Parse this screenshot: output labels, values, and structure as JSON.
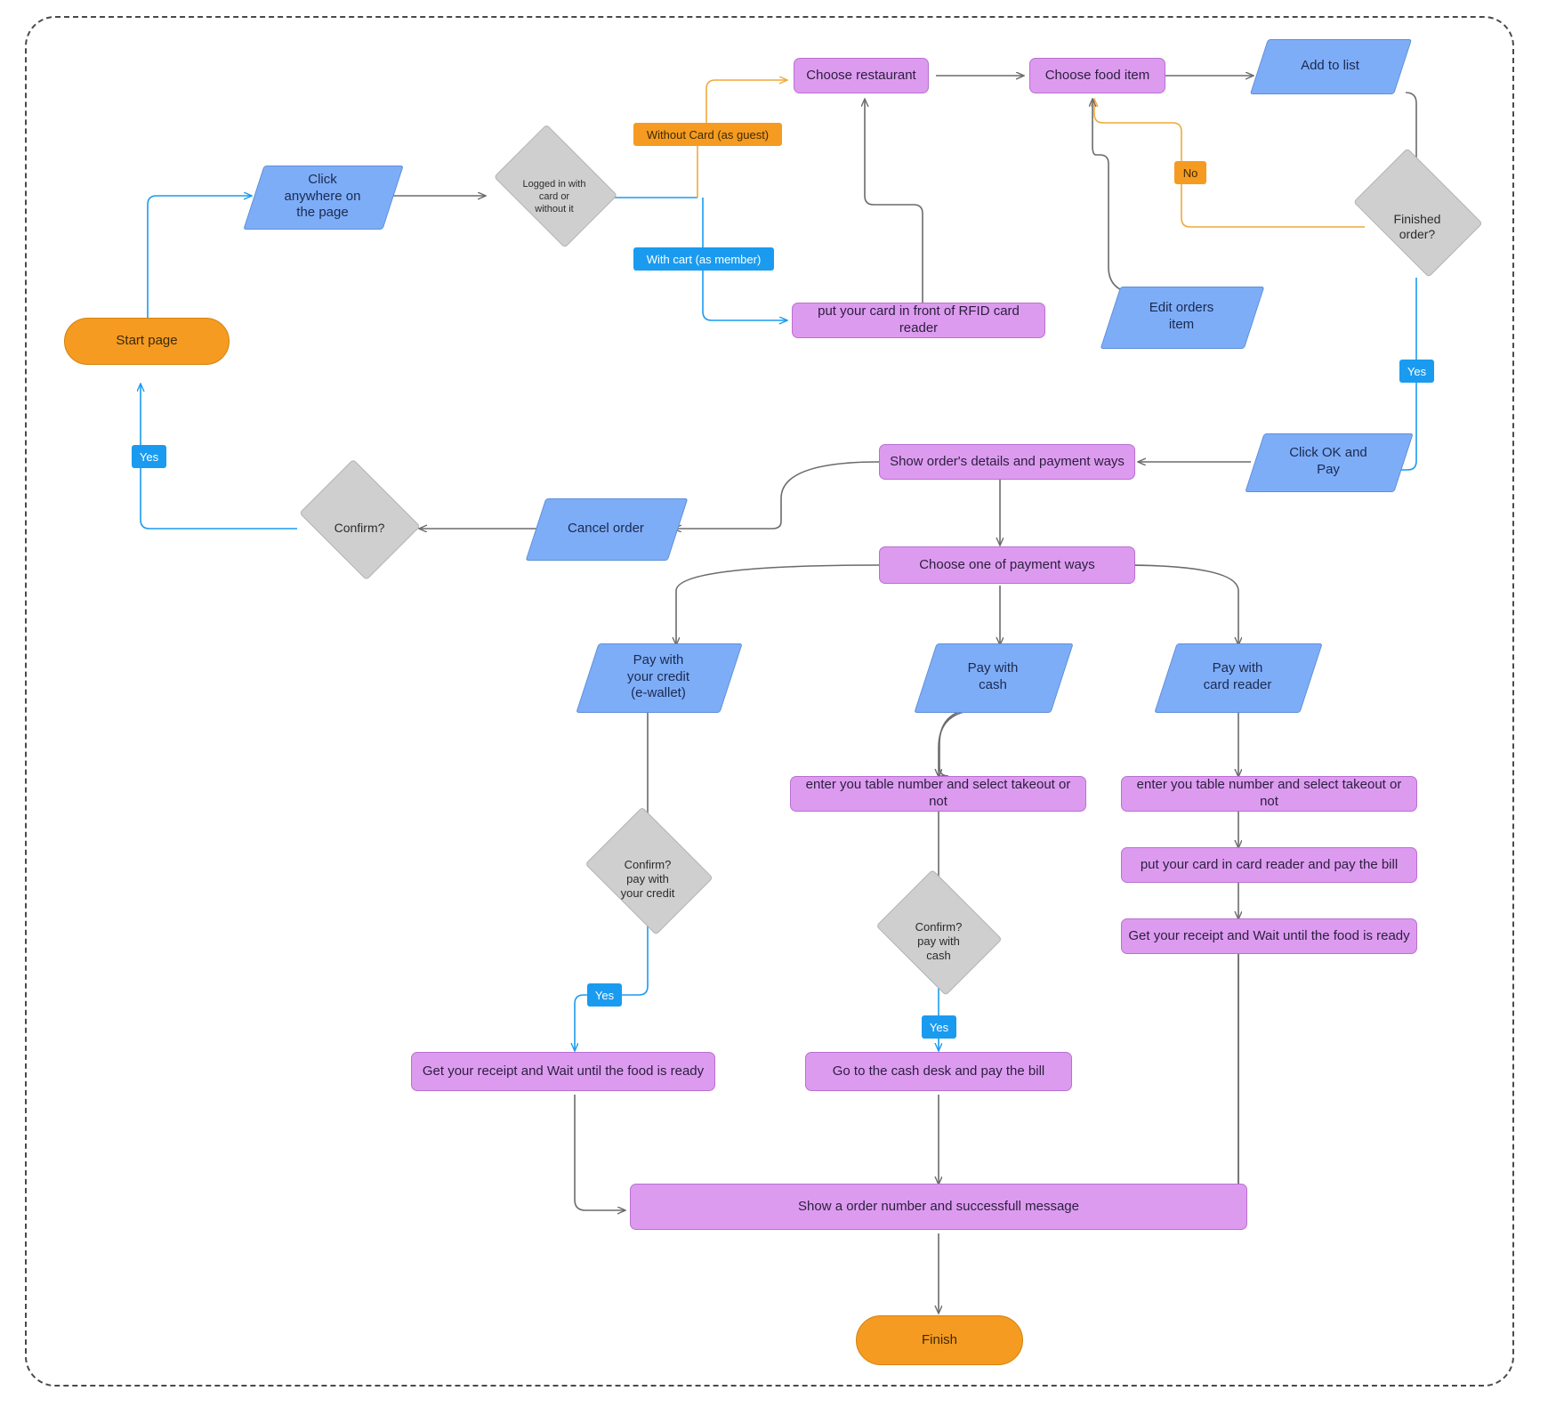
{
  "diagram": {
    "title": "Food ordering kiosk flowchart",
    "colors": {
      "process": "#dd9bf0",
      "io": "#7eadf8",
      "decision": "#cfcfcf",
      "terminator": "#f59b21",
      "edge_default": "#6b6b6b",
      "edge_blue": "#1a9bf0",
      "edge_orange": "#f0a93c",
      "label_blue": "#1a9bf0",
      "label_orange": "#f59b21"
    }
  },
  "nodes": {
    "start_page": "Start page",
    "click_anywhere": "Click\nanywhere on\nthe page",
    "logged_in": "Logged in with\ncard or\nwithout it",
    "choose_restaurant": "Choose restaurant",
    "choose_food_item": "Choose food item",
    "add_to_list": "Add to list",
    "rfid_reader": "put your card in front of RFID card reader",
    "finished_order": "Finished\norder?",
    "edit_orders_item": "Edit orders\nitem",
    "click_ok_and_pay": "Click OK and\nPay",
    "show_order_details": "Show order's details and payment ways",
    "cancel_order": "Cancel order",
    "confirm": "Confirm?",
    "choose_payment": "Choose one of payment ways",
    "pay_credit": "Pay with\nyour credit\n(e-wallet)",
    "pay_cash": "Pay with\ncash",
    "pay_card_reader": "Pay with\ncard reader",
    "confirm_credit": "Confirm?\npay with\nyour credit",
    "confirm_cash": "Confirm?\npay with\ncash",
    "table_number_cash": "enter you table number and select takeout or not",
    "table_number_card": "enter you table number and select takeout or not",
    "card_in_reader": "put your card in card reader and pay the bill",
    "receipt_card": "Get your receipt and Wait until the food is ready",
    "receipt_credit": "Get your receipt and Wait until the food is ready",
    "cash_desk": "Go to the cash desk and pay the bill",
    "order_number": "Show a order number and successfull message",
    "finish": "Finish"
  },
  "edge_labels": {
    "without_card": "Without Card (as guest)",
    "with_cart": "With cart (as member)",
    "no_finished": "No",
    "yes_finished": "Yes",
    "yes_confirm": "Yes",
    "yes_credit": "Yes",
    "yes_cash": "Yes"
  }
}
